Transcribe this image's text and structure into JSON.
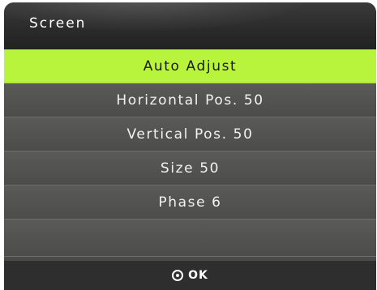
{
  "menu": {
    "title": "Screen",
    "items": [
      {
        "label": "Auto Adjust",
        "selected": true
      },
      {
        "label": "Horizontal Pos. 50",
        "selected": false
      },
      {
        "label": "Vertical Pos. 50",
        "selected": false
      },
      {
        "label": "Size 50",
        "selected": false
      },
      {
        "label": "Phase 6",
        "selected": false
      }
    ]
  },
  "footer": {
    "icon": "ok-button-icon",
    "label": "OK"
  },
  "colors": {
    "selected_highlight": "#b8f43b",
    "menu_background": "#4a4a48",
    "title_background": "#2a2a2a",
    "footer_background": "#2e2e2e"
  }
}
